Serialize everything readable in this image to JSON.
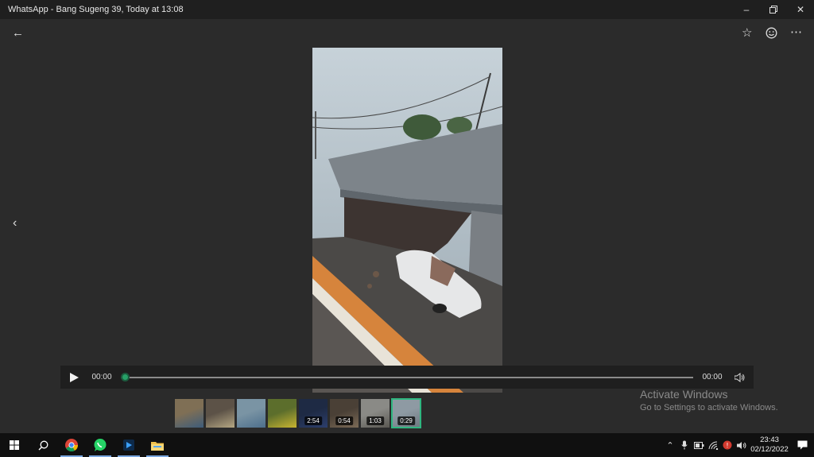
{
  "window": {
    "title": "WhatsApp - Bang Sugeng 39, Today at 13:08",
    "controls": [
      "minimize-icon",
      "restore-icon",
      "close-icon"
    ]
  },
  "toolbar": {
    "back_icon": "back-arrow-icon",
    "actions": [
      "star-icon",
      "emoji-icon",
      "more-icon"
    ]
  },
  "player": {
    "current_time": "00:00",
    "duration": "00:00",
    "progress": 0,
    "accent": "#27a067"
  },
  "thumbnails": [
    {
      "duration": "",
      "colors": [
        "#7f6f55",
        "#3e5c7a"
      ]
    },
    {
      "duration": "",
      "colors": [
        "#5c5247",
        "#b5a783"
      ]
    },
    {
      "duration": "",
      "colors": [
        "#7a94a4",
        "#4d6f8c"
      ]
    },
    {
      "duration": "",
      "colors": [
        "#5c6e2c",
        "#c9b531"
      ]
    },
    {
      "duration": "2:54",
      "colors": [
        "#1e2a44",
        "#2c3e6c"
      ]
    },
    {
      "duration": "0:54",
      "colors": [
        "#4a4036",
        "#7b6a56"
      ]
    },
    {
      "duration": "1:03",
      "colors": [
        "#8a8a86",
        "#5a5852"
      ]
    },
    {
      "duration": "0:29",
      "colors": [
        "#8e9aa3",
        "#6d7780"
      ],
      "active": true
    }
  ],
  "watermark": {
    "line1": "Activate Windows",
    "line2": "Go to Settings to activate Windows."
  },
  "taskbar": {
    "apps": [
      "windows-start-icon",
      "search-icon",
      "chrome-icon",
      "whatsapp-icon",
      "media-app-icon",
      "file-explorer-icon"
    ],
    "time": "23:43",
    "date": "02/12/2022"
  }
}
